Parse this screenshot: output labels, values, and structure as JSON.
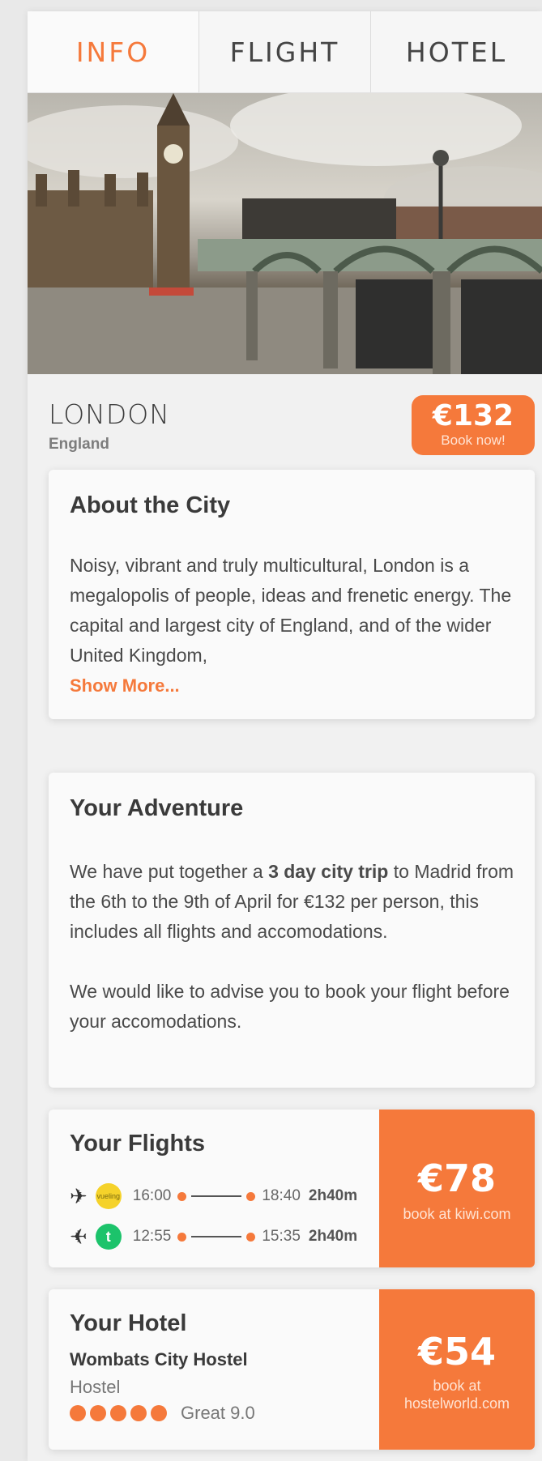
{
  "tabs": [
    {
      "label": "INFO",
      "active": true
    },
    {
      "label": "FLIGHT",
      "active": false
    },
    {
      "label": "HOTEL",
      "active": false
    }
  ],
  "destination": {
    "city": "LONDON",
    "country": "England",
    "price": "€132",
    "price_cta": "Book now!"
  },
  "about": {
    "title": "About the City",
    "text": "Noisy, vibrant and truly multicultural, London is a megalopolis of people, ideas and frenetic energy. The capital and largest city of England, and of the wider United Kingdom,",
    "show_more": "Show More..."
  },
  "adventure": {
    "title": "Your Adventure",
    "p1_before": "We have put together a ",
    "p1_bold": "3 day city trip",
    "p1_after": " to Madrid from the 6th to the 9th of April for €132 per person, this includes all flights and accomodations.",
    "p2": "We would like to advise you to book your flight before your accomodations."
  },
  "flights": {
    "title": "Your Flights",
    "items": [
      {
        "airline_logo_text": "vueling",
        "depart": "16:00",
        "arrive": "18:40",
        "duration": "2h40m",
        "logo_color": "#f5d22a"
      },
      {
        "airline_logo_text": "t",
        "depart": "12:55",
        "arrive": "15:35",
        "duration": "2h40m",
        "logo_color": "#1cc36b"
      }
    ],
    "price": "€78",
    "cta": "book at kiwi.com"
  },
  "hotel": {
    "title": "Your Hotel",
    "name": "Wombats City Hostel",
    "type": "Hostel",
    "rating_label": "Great 9.0",
    "rating_dots": 5,
    "price": "€54",
    "cta_line1": "book at",
    "cta_line2": "hostelworld.com"
  },
  "colors": {
    "accent": "#f5793b"
  }
}
